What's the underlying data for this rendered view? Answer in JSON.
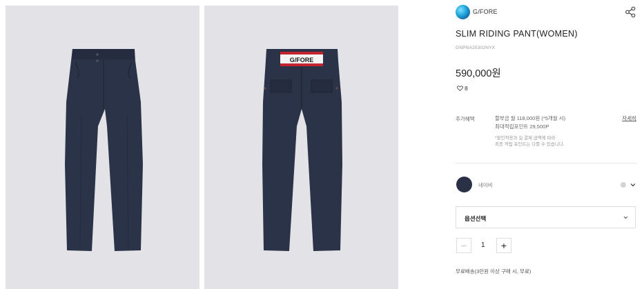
{
  "brand": {
    "name": "G/FORE",
    "logo_icon": "brand-logo-icon"
  },
  "product": {
    "title": "SLIM RIDING PANT(WOMEN)",
    "code": "GNPNA25302NYX",
    "price": "590,000원",
    "likes": "8"
  },
  "benefits": {
    "label": "추가혜택",
    "installment": "할부금 월 118,000원 (*5개월 시)",
    "points": "최대적립포인트 29,500P",
    "note_1": "*할인적용과 실 결제 금액에 따라",
    "note_2": "최종 적립 포인트는 다를 수 있습니다.",
    "detail_link": "자세히"
  },
  "color": {
    "name": "네이비",
    "swatch": "#2a3147",
    "dot": "#d4d4d4"
  },
  "option_select": {
    "label": "옵션선택"
  },
  "quantity": {
    "minus": "−",
    "value": "1",
    "plus": "+"
  },
  "shipping": "무료배송(3만원 이상 구매 시, 무료)",
  "colors": {
    "pants": "#2b3349",
    "background": "#e3e2e6",
    "waistband_red": "#c4242f"
  },
  "waistband_text": "G/FORE"
}
